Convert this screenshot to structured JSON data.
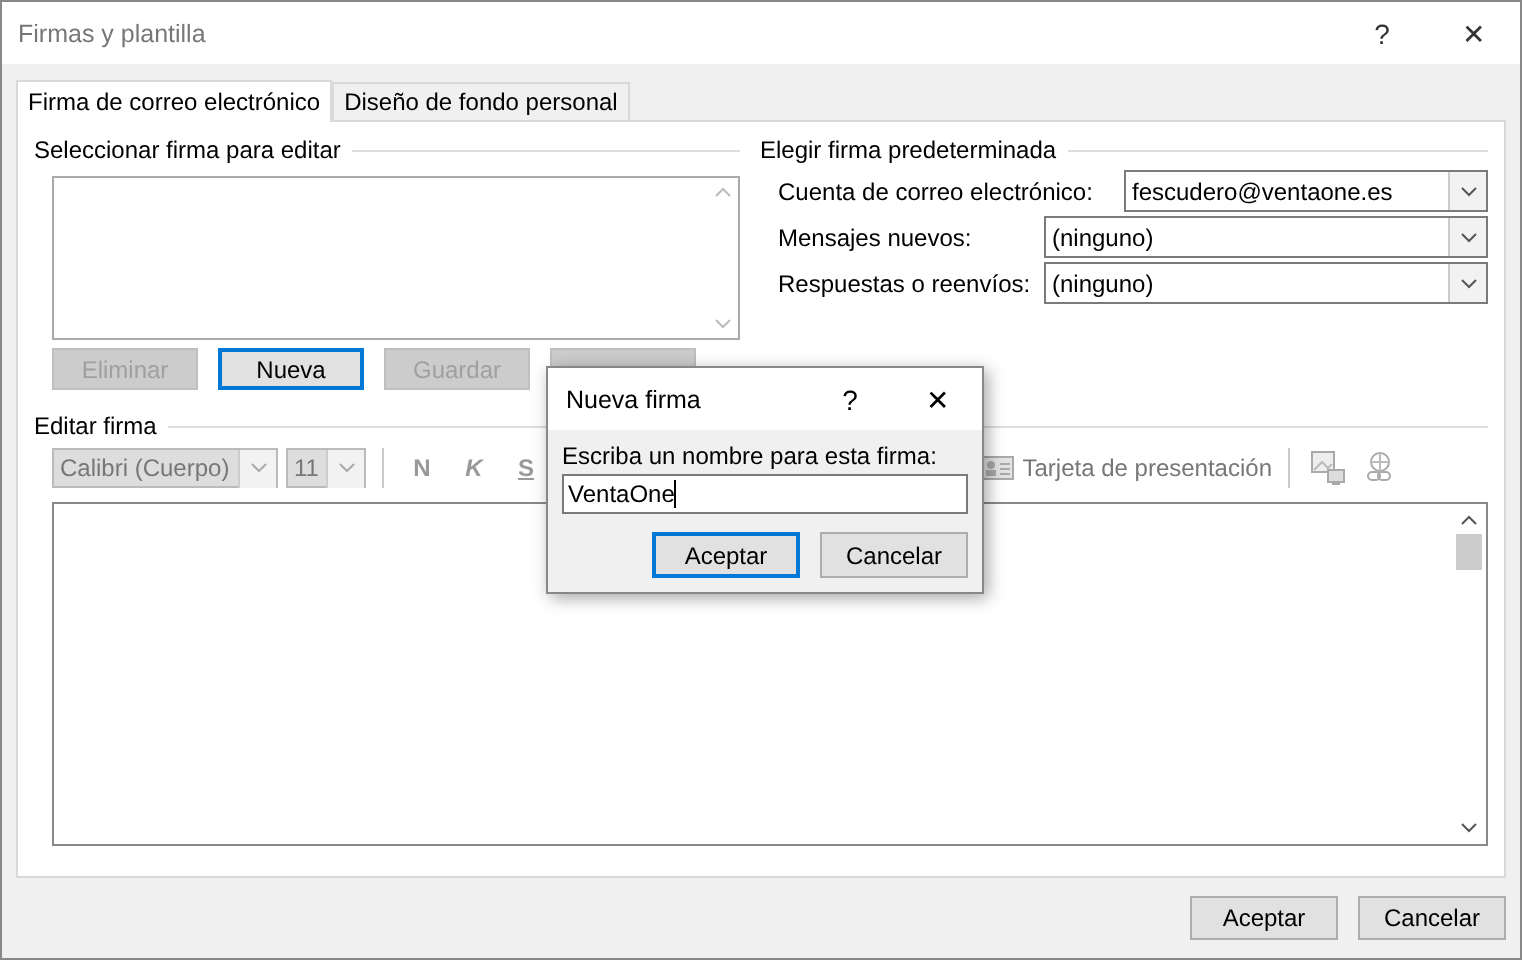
{
  "window": {
    "title": "Firmas y plantilla",
    "help": "?",
    "close": "✕"
  },
  "tabs": [
    {
      "label": "Firma de correo electrónico",
      "selected": true
    },
    {
      "label": "Diseño de fondo personal",
      "selected": false
    }
  ],
  "select_section": {
    "title": "Seleccionar firma para editar",
    "buttons": [
      {
        "label": "Eliminar",
        "disabled": true,
        "focused": false
      },
      {
        "label": "Nueva",
        "disabled": false,
        "focused": true
      },
      {
        "label": "Guardar",
        "disabled": true,
        "focused": false
      }
    ]
  },
  "default_section": {
    "title": "Elegir firma predeterminada",
    "fields": [
      {
        "label": "Cuenta de correo electrónico:",
        "value": "fescudero@ventaone.es"
      },
      {
        "label": "Mensajes nuevos:",
        "value": "(ninguno)"
      },
      {
        "label": "Respuestas o reenvíos:",
        "value": "(ninguno)"
      }
    ]
  },
  "edit_section": {
    "title": "Editar firma",
    "font": "Calibri (Cuerpo)",
    "size": "11",
    "format_buttons": [
      "N",
      "K",
      "S"
    ],
    "business_card": "Tarjeta de presentación"
  },
  "dialog": {
    "title": "Nueva firma",
    "help": "?",
    "close": "✕",
    "label": "Escriba un nombre para esta firma:",
    "value": "VentaOne",
    "buttons": [
      {
        "label": "Aceptar",
        "focused": true
      },
      {
        "label": "Cancelar",
        "focused": false
      }
    ]
  },
  "footer_buttons": [
    "Aceptar",
    "Cancelar"
  ]
}
